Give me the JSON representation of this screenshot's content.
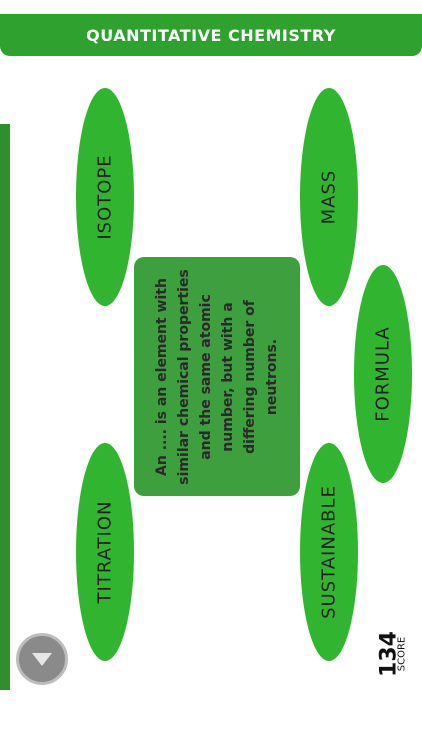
{
  "header": {
    "title": "QUANTITATIVE CHEMISTRY"
  },
  "question": {
    "text": "An .... is an element with similar chemical properties and the same atomic number, but with a differing number of neutrons."
  },
  "answers": [
    {
      "label": "ISOTOPE"
    },
    {
      "label": "MASS"
    },
    {
      "label": "FORMULA"
    },
    {
      "label": "TITRATION"
    },
    {
      "label": "SUSTAINABLE"
    }
  ],
  "score": {
    "value": "134",
    "label": "SCORE"
  },
  "controls": {
    "nav_icon": "chevron-down-icon"
  },
  "colors": {
    "title_bar": "#2fa12f",
    "bubble": "#31b531",
    "card": "#3d9f3d",
    "rail": "#2f8f2f",
    "button": "#8a8a8a"
  }
}
